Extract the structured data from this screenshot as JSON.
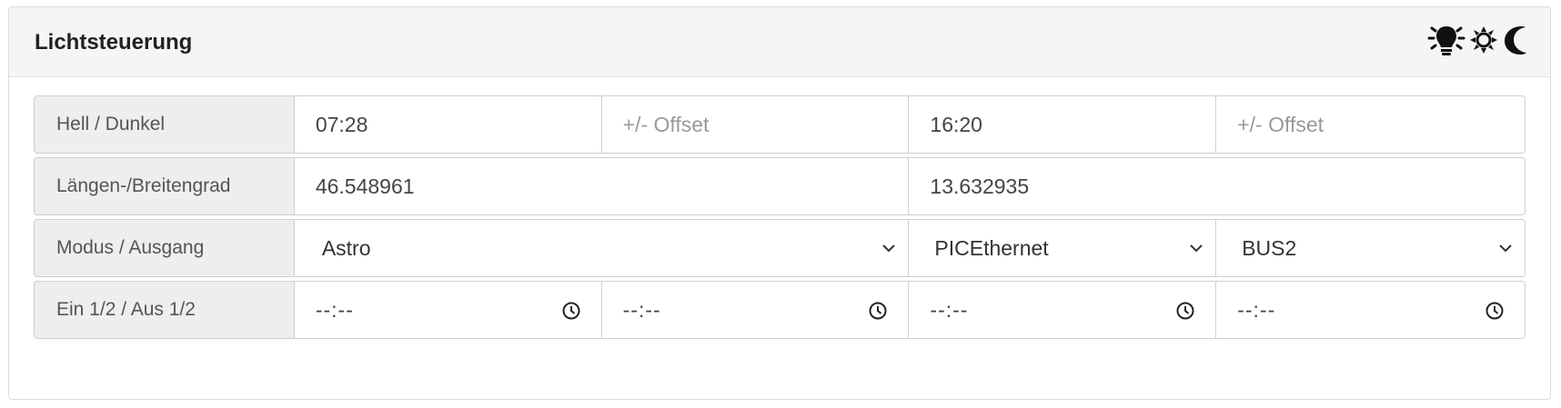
{
  "panel": {
    "title": "Lichtsteuerung",
    "icons": [
      "lightbulb-icon",
      "sun-icon",
      "moon-icon"
    ]
  },
  "rows": {
    "hell_dunkel": {
      "label": "Hell / Dunkel",
      "sunrise": "07:28",
      "sunrise_offset_placeholder": "+/- Offset",
      "sunset": "16:20",
      "sunset_offset_placeholder": "+/- Offset"
    },
    "coords": {
      "label": "Längen-/Breitengrad",
      "latitude": "46.548961",
      "longitude": "13.632935"
    },
    "modus": {
      "label": "Modus / Ausgang",
      "mode": "Astro",
      "interface": "PICEthernet",
      "output": "BUS2"
    },
    "times": {
      "label": "Ein 1/2 / Aus 1/2",
      "on1": "--:--",
      "on2": "--:--",
      "off1": "--:--",
      "off2": "--:--"
    }
  },
  "colors": {
    "header_bg": "#f5f5f5",
    "label_bg": "#eeeeee",
    "border": "#cfcfcf"
  }
}
